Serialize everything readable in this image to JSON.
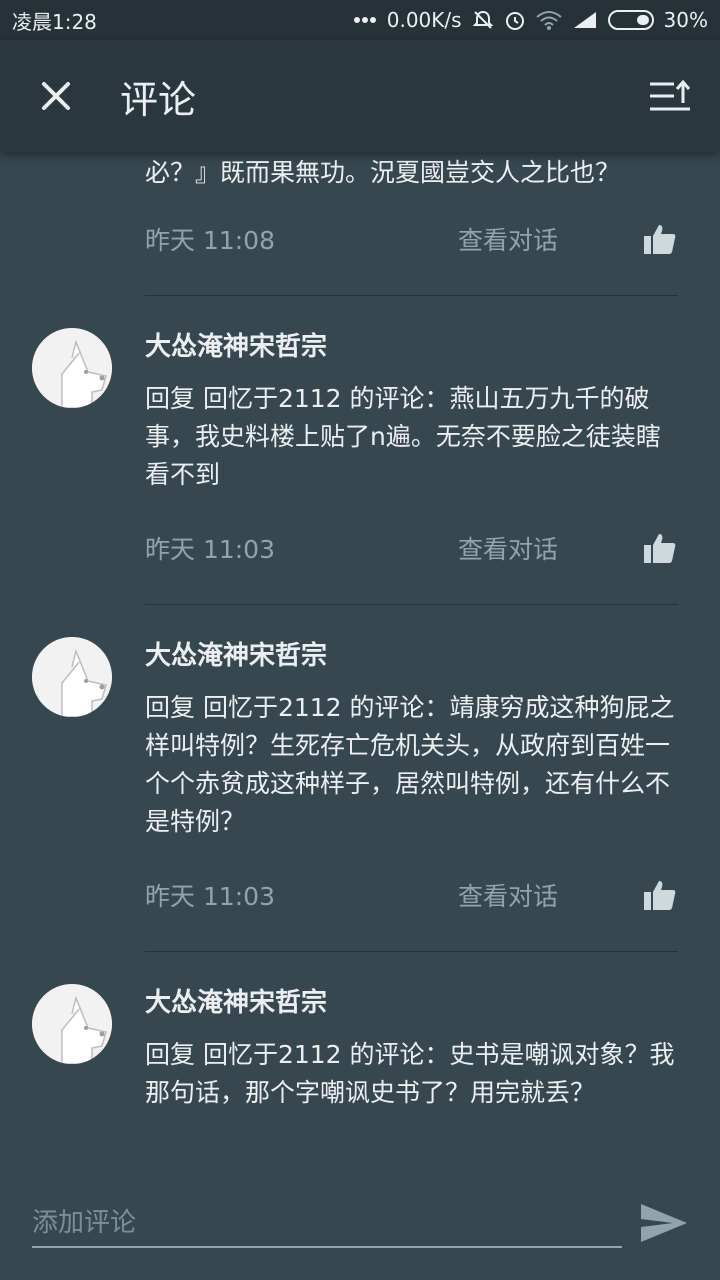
{
  "status_bar": {
    "time": "凌晨1:28",
    "network_speed": "0.00K/s",
    "battery": "30%",
    "icons": [
      "dots-icon",
      "mute-icon",
      "alarm-icon",
      "wifi-icon",
      "signal-icon",
      "battery-icon"
    ]
  },
  "app_bar": {
    "title": "评论",
    "close_icon": "close-icon",
    "sort_icon": "sort-icon"
  },
  "comments": [
    {
      "partial_text": "必？』既而果無功。況夏國豈交人之比也？",
      "time": "昨天 11:08",
      "view_conversation": "查看对话"
    },
    {
      "author": "大怂淹神宋哲宗",
      "text": "回复 回忆于2112 的评论：燕山五万九千的破事，我史料楼上贴了n遍。无奈不要脸之徒装瞎看不到",
      "time": "昨天 11:03",
      "view_conversation": "查看对话"
    },
    {
      "author": "大怂淹神宋哲宗",
      "text": "回复 回忆于2112 的评论：靖康穷成这种狗屁之样叫特例？生死存亡危机关头，从政府到百姓一个个赤贫成这种样子，居然叫特例，还有什么不是特例？",
      "time": "昨天 11:03",
      "view_conversation": "查看对话"
    },
    {
      "author": "大怂淹神宋哲宗",
      "text": "回复 回忆于2112 的评论：史书是嘲讽对象？我那句话，那个字嘲讽史书了？用完就丢？"
    }
  ],
  "input": {
    "placeholder": "添加评论",
    "value": ""
  },
  "colors": {
    "background": "#37474f",
    "app_bar": "#2b373e",
    "status_bar": "#263238",
    "muted_text": "#90a4ae"
  }
}
